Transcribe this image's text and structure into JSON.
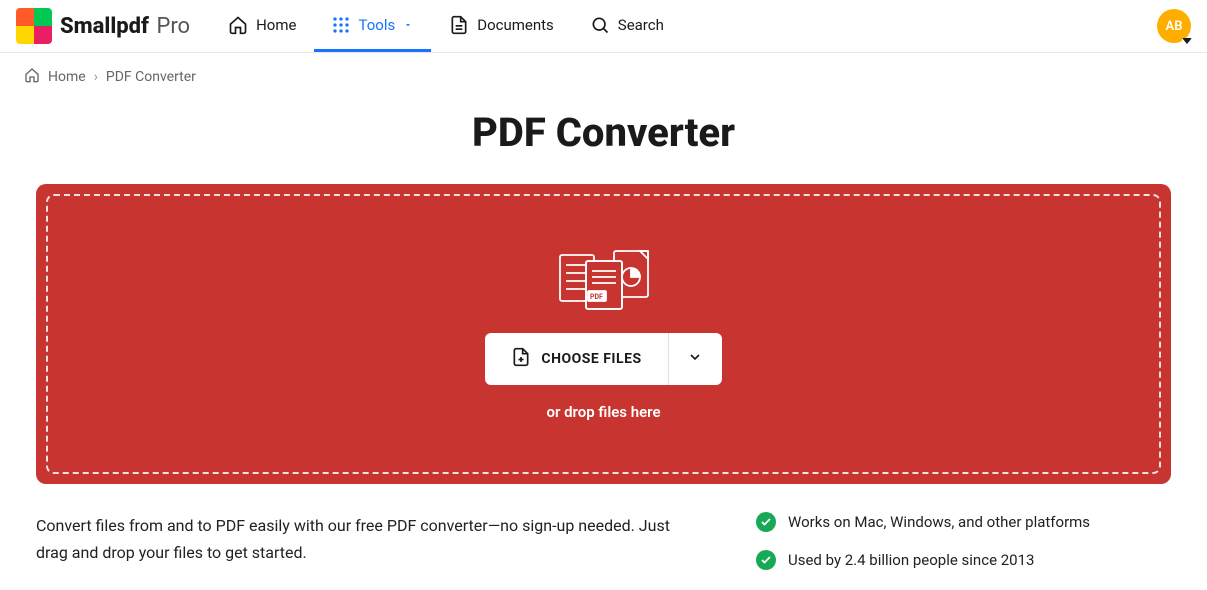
{
  "brand": {
    "name": "Smallpdf",
    "suffix": "Pro"
  },
  "nav": {
    "home": "Home",
    "tools": "Tools",
    "documents": "Documents",
    "search": "Search"
  },
  "avatar": {
    "initials": "AB"
  },
  "breadcrumb": {
    "home": "Home",
    "current": "PDF Converter"
  },
  "page": {
    "title": "PDF Converter"
  },
  "dropzone": {
    "choose_label": "CHOOSE FILES",
    "hint": "or drop files here"
  },
  "description": "Convert files from and to PDF easily with our free PDF converter—no sign-up needed. Just drag and drop your files to get started.",
  "features": [
    "Works on Mac, Windows, and other platforms",
    "Used by 2.4 billion people since 2013"
  ],
  "colors": {
    "accent": "#1673ff",
    "dropzone": "#c8342f",
    "avatar": "#ffae00",
    "check": "#18a957"
  }
}
